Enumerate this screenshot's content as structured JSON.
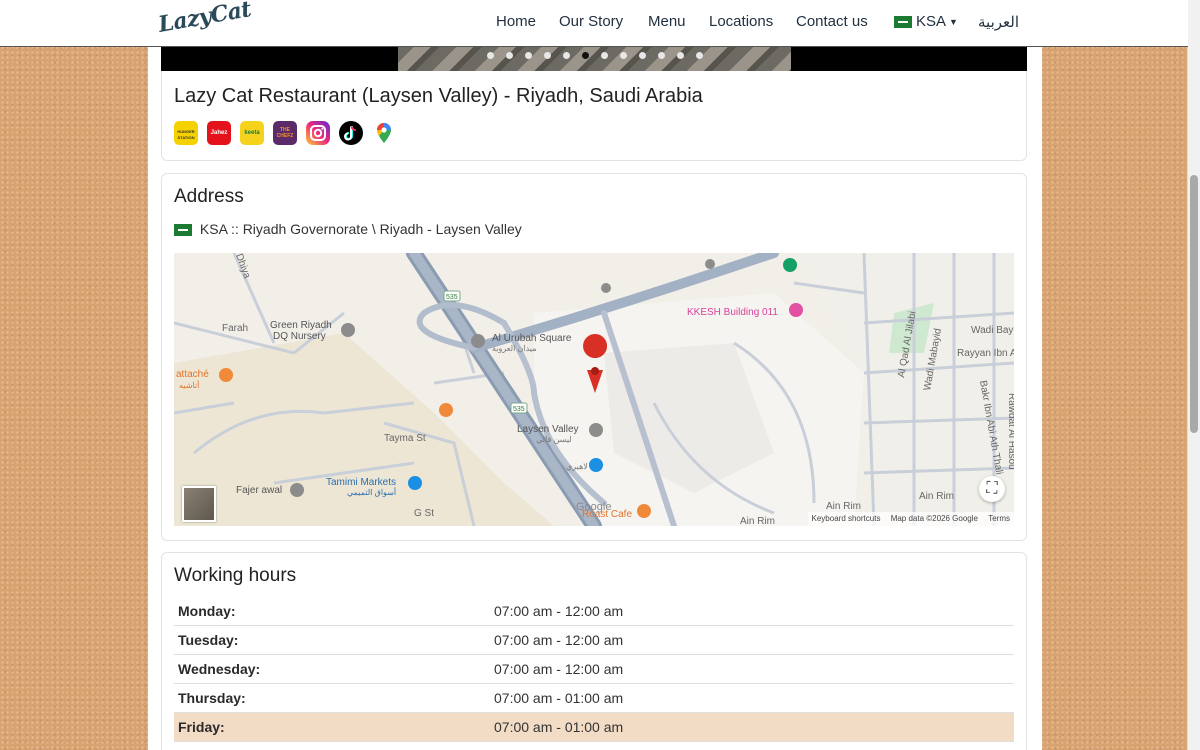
{
  "nav": {
    "logo": "LazyCat",
    "links": [
      "Home",
      "Our Story",
      "Menu",
      "Locations",
      "Contact us"
    ],
    "country": "KSA",
    "language": "العربية"
  },
  "carousel": {
    "slide_count": 12,
    "active_index": 5
  },
  "restaurant": {
    "title": "Lazy Cat Restaurant (Laysen Valley) - Riyadh, Saudi Arabia",
    "app_icons": [
      "hungerstation-icon",
      "jahez-icon",
      "keeta-icon",
      "the-chefz-icon",
      "instagram-icon",
      "tiktok-icon",
      "google-maps-icon"
    ],
    "app_labels": [
      "HUNGER STATION",
      "Jahez",
      "keeta",
      "THE CHEFZ"
    ]
  },
  "address": {
    "heading": "Address",
    "line": "KSA :: Riyadh Governorate \\ Riyadh - Laysen Valley"
  },
  "map": {
    "labels": {
      "green_riyadh": "Green Riyadh",
      "dq_nursery": "DQ Nursery",
      "al_urubah": "Al Urubah Square",
      "al_urubah_ar": "ميدان العروبة",
      "kkesh": "KKESH Building 011",
      "laysen": "Laysen Valley",
      "laysen_ar": "ليسن فالي",
      "tamimi": "Tamimi Markets",
      "tamimi_ar": "أسواق التميمي",
      "fajer": "Fajer awal",
      "attache": "attaché",
      "attache_ar": "أتاشيه",
      "farah": "Farah",
      "tayma": "Tayma St",
      "g_st": "G St",
      "ain_rim": "Ain Rim",
      "ain_rim2": "Ain Rim",
      "ain_rim3": "Ain Rim",
      "wadi_bayl": "Wadi Bayl",
      "rayyan": "Rayyan Ibn A",
      "rawdat": "Rawdat Al Hasou",
      "bakr": "Bakr Ibn Abi Ath Thali",
      "al_jilabi": "Al Qad Al Jilabi",
      "wadi_mabayid": "Wadi Mabayid",
      "dhiya": "Dhiya",
      "roast": "Roast Cafe",
      "lahiri": "لاهيري",
      "route": "535",
      "route2": "535",
      "google": "Google"
    },
    "footer": [
      "Keyboard shortcuts",
      "Map data ©2026 Google",
      "Terms"
    ]
  },
  "hours": {
    "heading": "Working hours",
    "rows": [
      {
        "day": "Monday:",
        "time": "07:00 am - 12:00 am"
      },
      {
        "day": "Tuesday:",
        "time": "07:00 am - 12:00 am"
      },
      {
        "day": "Wednesday:",
        "time": "07:00 am - 12:00 am"
      },
      {
        "day": "Thursday:",
        "time": "07:00 am - 01:00 am"
      },
      {
        "day": "Friday:",
        "time": "07:00 am - 01:00 am"
      }
    ],
    "today_index": 4
  },
  "colors": {
    "map_pin": "#d93025",
    "today_row": "#f2dcc6",
    "page_bg": "#d9a271"
  }
}
